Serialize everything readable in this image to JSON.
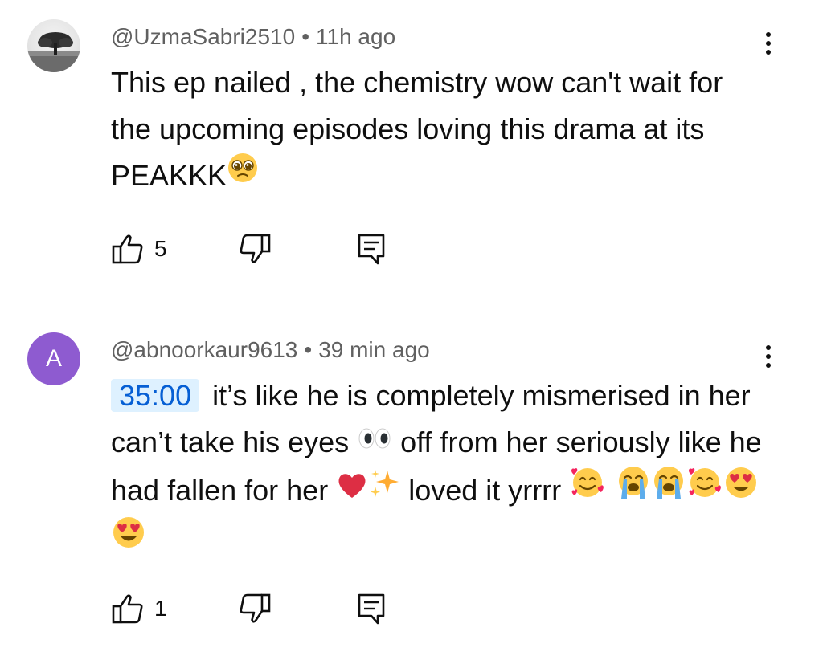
{
  "comments": [
    {
      "handle": "@UzmaSabri2510",
      "separator": "•",
      "time": "11h ago",
      "text_main": "This ep nailed ,  the chemistry wow can't wait for the upcoming episodes loving this drama at its PEAKKK",
      "emoji_icons": [
        "pleading-face-icon"
      ],
      "like_count": "5",
      "avatar_type": "photo"
    },
    {
      "handle": "@abnoorkaur9613",
      "separator": "•",
      "time": "39 min ago",
      "timestamp_link": "35:00",
      "text_part1": " it’s like he is completely mismerised in her can’t take his eyes ",
      "text_part2": " off from her seriously like he had fallen for her ",
      "text_part3": " loved it yrrrr ",
      "emoji_icons": [
        "eyes-icon",
        "red-heart-icon",
        "sparkles-icon",
        "smiling-face-with-hearts-icon",
        "loudly-crying-face-icon",
        "loudly-crying-face-icon",
        "smiling-face-with-hearts-icon",
        "heart-eyes-icon",
        "heart-eyes-icon"
      ],
      "like_count": "1",
      "avatar_type": "letter",
      "avatar_letter": "A",
      "avatar_color": "#8e5bd0"
    }
  ],
  "colors": {
    "meta_text": "#606060",
    "body_text": "#0f0f0f",
    "timestamp_link": "#065fd4",
    "timestamp_bg": "#def1ff"
  },
  "icons": {
    "like": "thumbs-up-icon",
    "dislike": "thumbs-down-icon",
    "reply": "reply-icon",
    "menu": "more-vertical-icon"
  }
}
